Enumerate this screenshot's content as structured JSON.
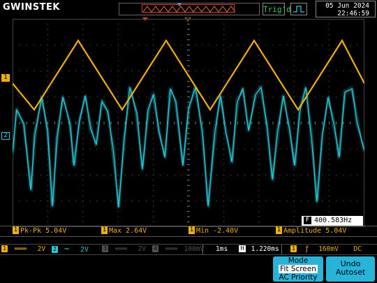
{
  "header": {
    "brand": "GWINSTEK",
    "trigger_status": "Trig'd",
    "date": "05 Jun 2024",
    "time": "22:46:59"
  },
  "markers": {
    "ch1_marker": "1",
    "ch2_marker": "2"
  },
  "frequency": {
    "icon": "F",
    "value": "400.583Hz"
  },
  "measurements": [
    {
      "channel": "1",
      "label": "Pk-Pk 5.04V"
    },
    {
      "channel": "1",
      "label": "Max 2.64V"
    },
    {
      "channel": "1",
      "label": "Min -2.40V"
    },
    {
      "channel": "1",
      "label": "Amplitude 5.04V"
    }
  ],
  "status": {
    "ch1": {
      "num": "1",
      "coupling": "═══",
      "scale": "2V",
      "color": "#f0b000"
    },
    "ch2": {
      "num": "2",
      "coupling": "∼",
      "scale": "2V",
      "color": "#28c8d8"
    },
    "ch3": {
      "num": "3",
      "coupling": "═══",
      "scale": "2V",
      "color": "#505050"
    },
    "ch4": {
      "num": "4",
      "coupling": "═══",
      "scale": "100mV",
      "color": "#505050"
    },
    "timebase": "1ms",
    "h_icon": "H",
    "h_position": "1.220ms",
    "trig_src": "1",
    "trig_slope": "ƒ",
    "trig_level": "160mV",
    "trig_coupling": "DC"
  },
  "menu": {
    "mode_title": "Mode",
    "mode_selected": "Fit Screen",
    "mode_option": "AC Priority",
    "undo_line1": "Undo",
    "undo_line2": "Autoset"
  },
  "colors": {
    "ch1": "#f0b000",
    "ch2": "#28c8d8",
    "grid": "#3a3a3a",
    "menu": "#28b4d8"
  }
}
